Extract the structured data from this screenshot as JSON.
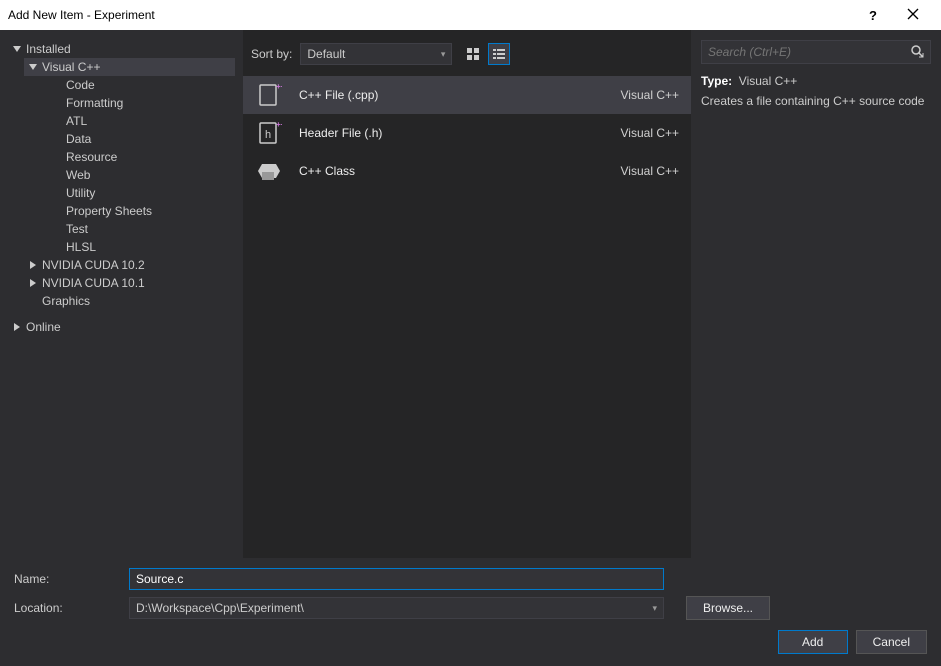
{
  "window": {
    "title": "Add New Item - Experiment"
  },
  "tree": {
    "installed": "Installed",
    "visual_cpp": "Visual C++",
    "children": [
      "Code",
      "Formatting",
      "ATL",
      "Data",
      "Resource",
      "Web",
      "Utility",
      "Property Sheets",
      "Test",
      "HLSL"
    ],
    "cuda102": "NVIDIA CUDA 10.2",
    "cuda101": "NVIDIA CUDA 10.1",
    "graphics": "Graphics",
    "online": "Online"
  },
  "center": {
    "sort_label": "Sort by:",
    "sort_value": "Default"
  },
  "items": [
    {
      "label": "C++ File (.cpp)",
      "lang": "Visual C++"
    },
    {
      "label": "Header File (.h)",
      "lang": "Visual C++"
    },
    {
      "label": "C++ Class",
      "lang": "Visual C++"
    }
  ],
  "right": {
    "search_placeholder": "Search (Ctrl+E)",
    "type_label": "Type:",
    "type_value": "Visual C++",
    "description": "Creates a file containing C++ source code"
  },
  "bottom": {
    "name_label": "Name:",
    "name_value": "Source.c",
    "location_label": "Location:",
    "location_value": "D:\\Workspace\\Cpp\\Experiment\\",
    "browse": "Browse...",
    "add": "Add",
    "cancel": "Cancel"
  }
}
